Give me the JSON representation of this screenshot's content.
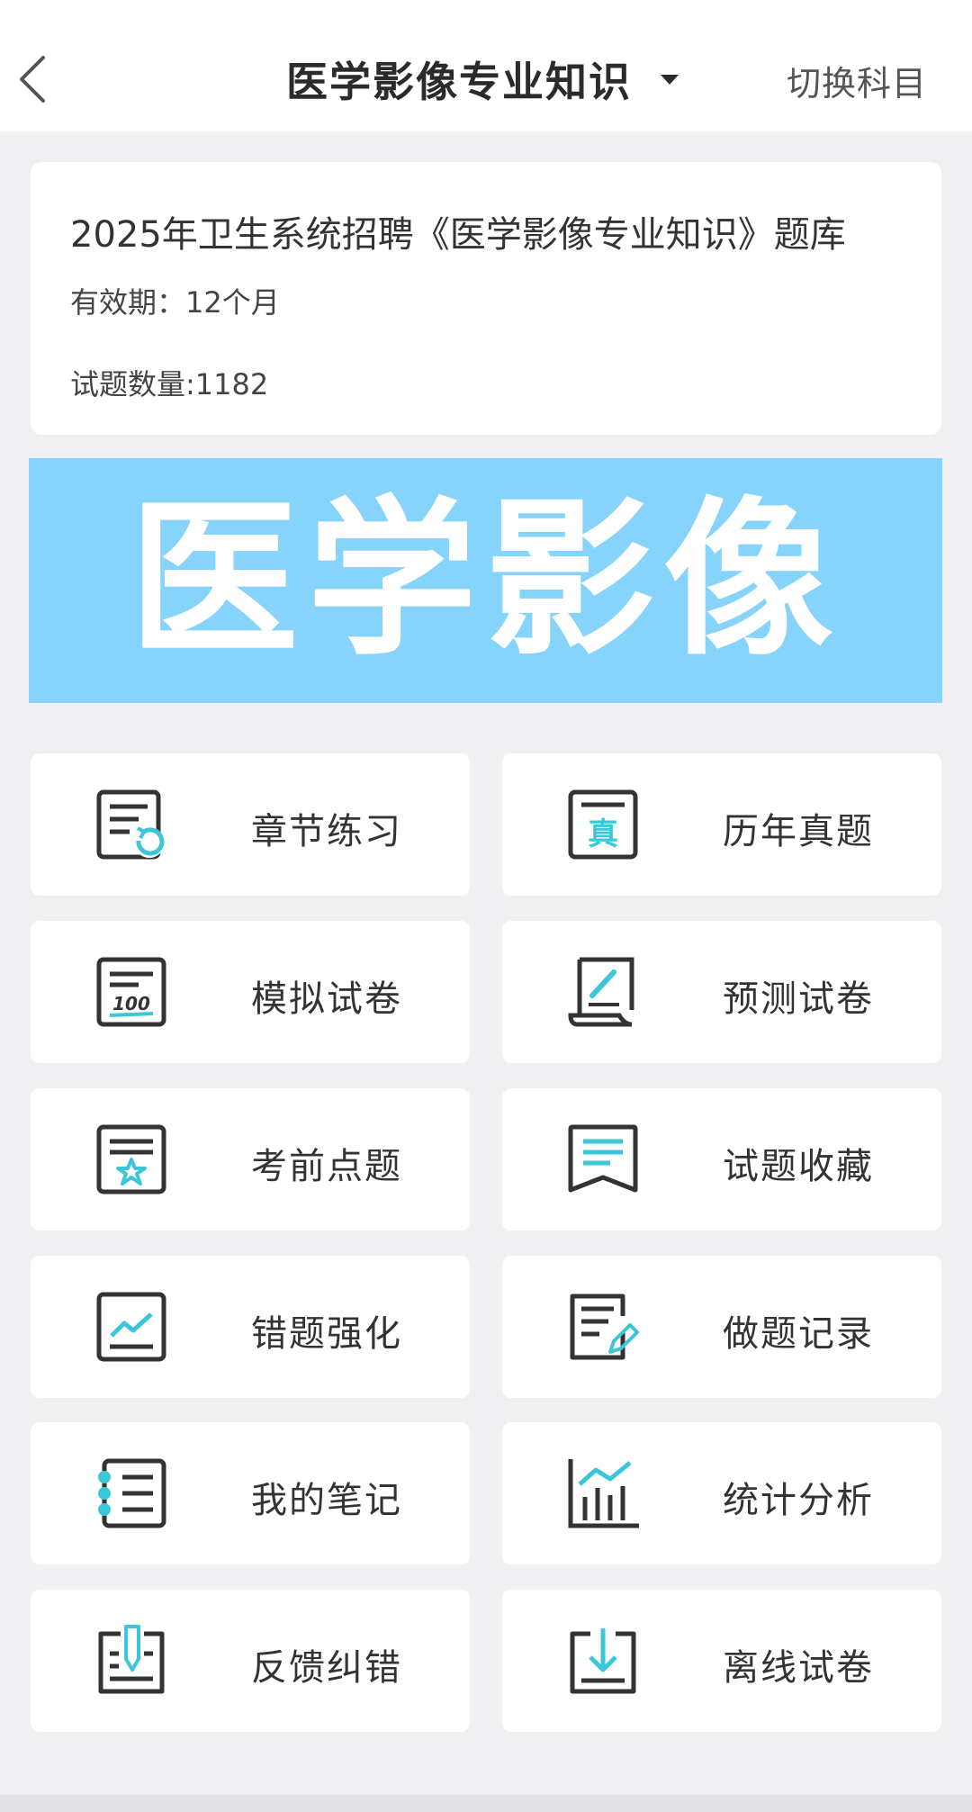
{
  "header": {
    "title": "医学影像专业知识",
    "switch_label": "切换科目"
  },
  "info": {
    "title": "2025年卫生系统招聘《医学影像专业知识》题库",
    "validity": "有效期：12个月",
    "count": "试题数量:1182"
  },
  "banner": {
    "text": "医学影像"
  },
  "menu": [
    {
      "label": "章节练习",
      "icon": "chapter-practice-icon"
    },
    {
      "label": "历年真题",
      "icon": "past-exams-icon"
    },
    {
      "label": "模拟试卷",
      "icon": "mock-paper-icon"
    },
    {
      "label": "预测试卷",
      "icon": "prediction-paper-icon"
    },
    {
      "label": "考前点题",
      "icon": "key-points-icon"
    },
    {
      "label": "试题收藏",
      "icon": "bookmark-icon"
    },
    {
      "label": "错题强化",
      "icon": "wrong-questions-icon"
    },
    {
      "label": "做题记录",
      "icon": "history-record-icon"
    },
    {
      "label": "我的笔记",
      "icon": "notes-icon"
    },
    {
      "label": "统计分析",
      "icon": "statistics-icon"
    },
    {
      "label": "反馈纠错",
      "icon": "feedback-icon"
    },
    {
      "label": "离线试卷",
      "icon": "offline-download-icon"
    }
  ],
  "colors": {
    "accent": "#3cc7d9",
    "icon_dark": "#333333",
    "banner_bg": "#86d3fb"
  }
}
